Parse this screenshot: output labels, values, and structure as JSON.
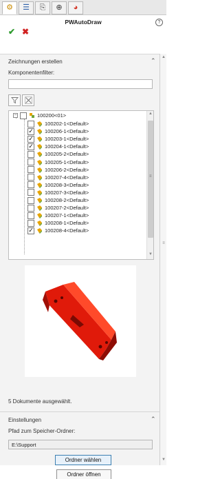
{
  "tabs": [
    {
      "icon": "feature-manager-icon",
      "glyph": "⚙",
      "color": "#c98a00"
    },
    {
      "icon": "property-manager-icon",
      "glyph": "☰",
      "color": "#2b5ea8"
    },
    {
      "icon": "configuration-manager-icon",
      "glyph": "⎘",
      "color": "#555555"
    },
    {
      "icon": "dimxpert-icon",
      "glyph": "⊕",
      "color": "#333333"
    },
    {
      "icon": "display-manager-icon",
      "glyph": "◕",
      "color": "#d43a2b"
    }
  ],
  "header": {
    "title": "PWAutoDraw",
    "help_symbol": "?",
    "ok_symbol": "✔",
    "cancel_symbol": "✖"
  },
  "section_create": {
    "title": "Zeichnungen erstellen",
    "filter_label": "Komponentenfilter:",
    "filter_value": ""
  },
  "tree": {
    "root": {
      "label": "100200<01>",
      "checked": false
    },
    "items": [
      {
        "label": "100202-1<Default>",
        "checked": false
      },
      {
        "label": "100206-1<Default>",
        "checked": true
      },
      {
        "label": "100203-1<Default>",
        "checked": true
      },
      {
        "label": "100204-1<Default>",
        "checked": true
      },
      {
        "label": "100205-2<Default>",
        "checked": false
      },
      {
        "label": "100205-1<Default>",
        "checked": false
      },
      {
        "label": "100206-2<Default>",
        "checked": false
      },
      {
        "label": "100207-4<Default>",
        "checked": false
      },
      {
        "label": "100208-3<Default>",
        "checked": false
      },
      {
        "label": "100207-3<Default>",
        "checked": false
      },
      {
        "label": "100208-2<Default>",
        "checked": false
      },
      {
        "label": "100207-2<Default>",
        "checked": false
      },
      {
        "label": "100207-1<Default>",
        "checked": false
      },
      {
        "label": "100208-1<Default>",
        "checked": false
      },
      {
        "label": "100208-4<Default>",
        "checked": true
      }
    ]
  },
  "status_text": "5 Dokumente ausgewählt.",
  "section_settings": {
    "title": "Einstellungen",
    "path_label": "Pfad zum Speicher-Ordner:",
    "path_value": "E:\\Support"
  },
  "buttons": {
    "choose_folder": "Ordner wählen",
    "open_folder": "Ordner öffnen"
  },
  "colors": {
    "accent": "#3c7fb1",
    "part_red": "#e01a0a",
    "ok_green": "#2f9b2f",
    "cancel_red": "#d02020"
  }
}
